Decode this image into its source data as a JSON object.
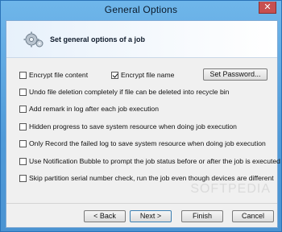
{
  "window": {
    "title": "General Options",
    "close_glyph": "✕"
  },
  "banner": {
    "text": "Set general options of a job",
    "icon": "gears-icon"
  },
  "options": {
    "encrypt_content": {
      "label": "Encrypt file content",
      "checked": false
    },
    "encrypt_name": {
      "label": "Encrypt file name",
      "checked": true
    },
    "set_password": "Set Password...",
    "items": [
      {
        "label": "Undo file deletion completely if file can be deleted into recycle bin",
        "checked": false
      },
      {
        "label": "Add remark in log after each job execution",
        "checked": false
      },
      {
        "label": "Hidden progress to save system resource when doing job execution",
        "checked": false
      },
      {
        "label": "Only Record the failed log to save system resource when doing job execution",
        "checked": false
      },
      {
        "label": "Use Notification Bubble to prompt the job status before or after the job is executed",
        "checked": false
      },
      {
        "label": "Skip partition serial number check, run the job even though devices are different",
        "checked": false
      }
    ]
  },
  "buttons": {
    "back": "< Back",
    "next": "Next >",
    "finish": "Finish",
    "cancel": "Cancel"
  },
  "watermark": "SOFTPEDIA"
}
